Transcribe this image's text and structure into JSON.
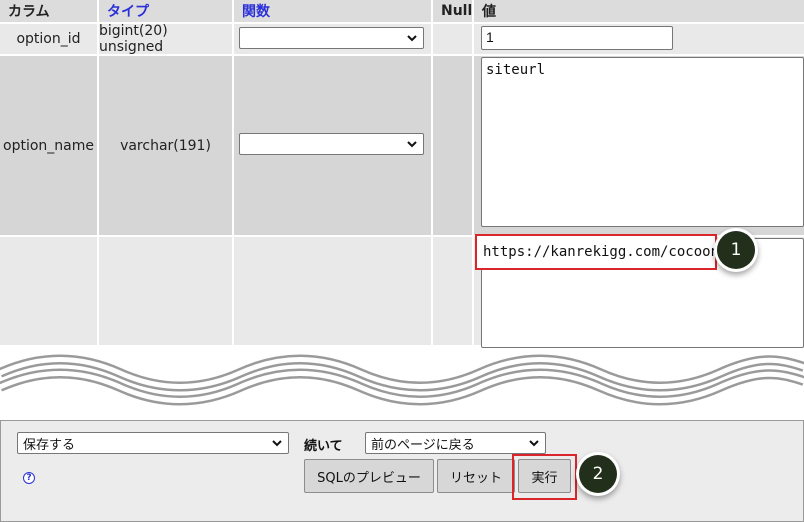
{
  "columns": {
    "column": "カラム",
    "type": "タイプ",
    "function": "関数",
    "null": "Null",
    "value": "値"
  },
  "rows": [
    {
      "name": "option_id",
      "type": "bigint(20) unsigned",
      "function": "",
      "value": "1"
    },
    {
      "name": "option_name",
      "type": "varchar(191)",
      "function": "",
      "value": "siteurl"
    },
    {
      "name": "",
      "type": "",
      "function": "",
      "value": "https://kanrekigg.com/cocoon"
    }
  ],
  "callouts": [
    "1",
    "2"
  ],
  "footer": {
    "save_select": "保存する",
    "then_label": "続いて",
    "then_select": "前のページに戻る",
    "help_icon": "?",
    "buttons": {
      "sql_preview": "SQLのプレビュー",
      "reset": "リセット",
      "execute": "実行"
    }
  },
  "colors": {
    "header_bg": "#dcdcdc",
    "link_blue": "#2a30d8",
    "highlight_red": "#d9262b",
    "badge_bg": "#22301b"
  }
}
